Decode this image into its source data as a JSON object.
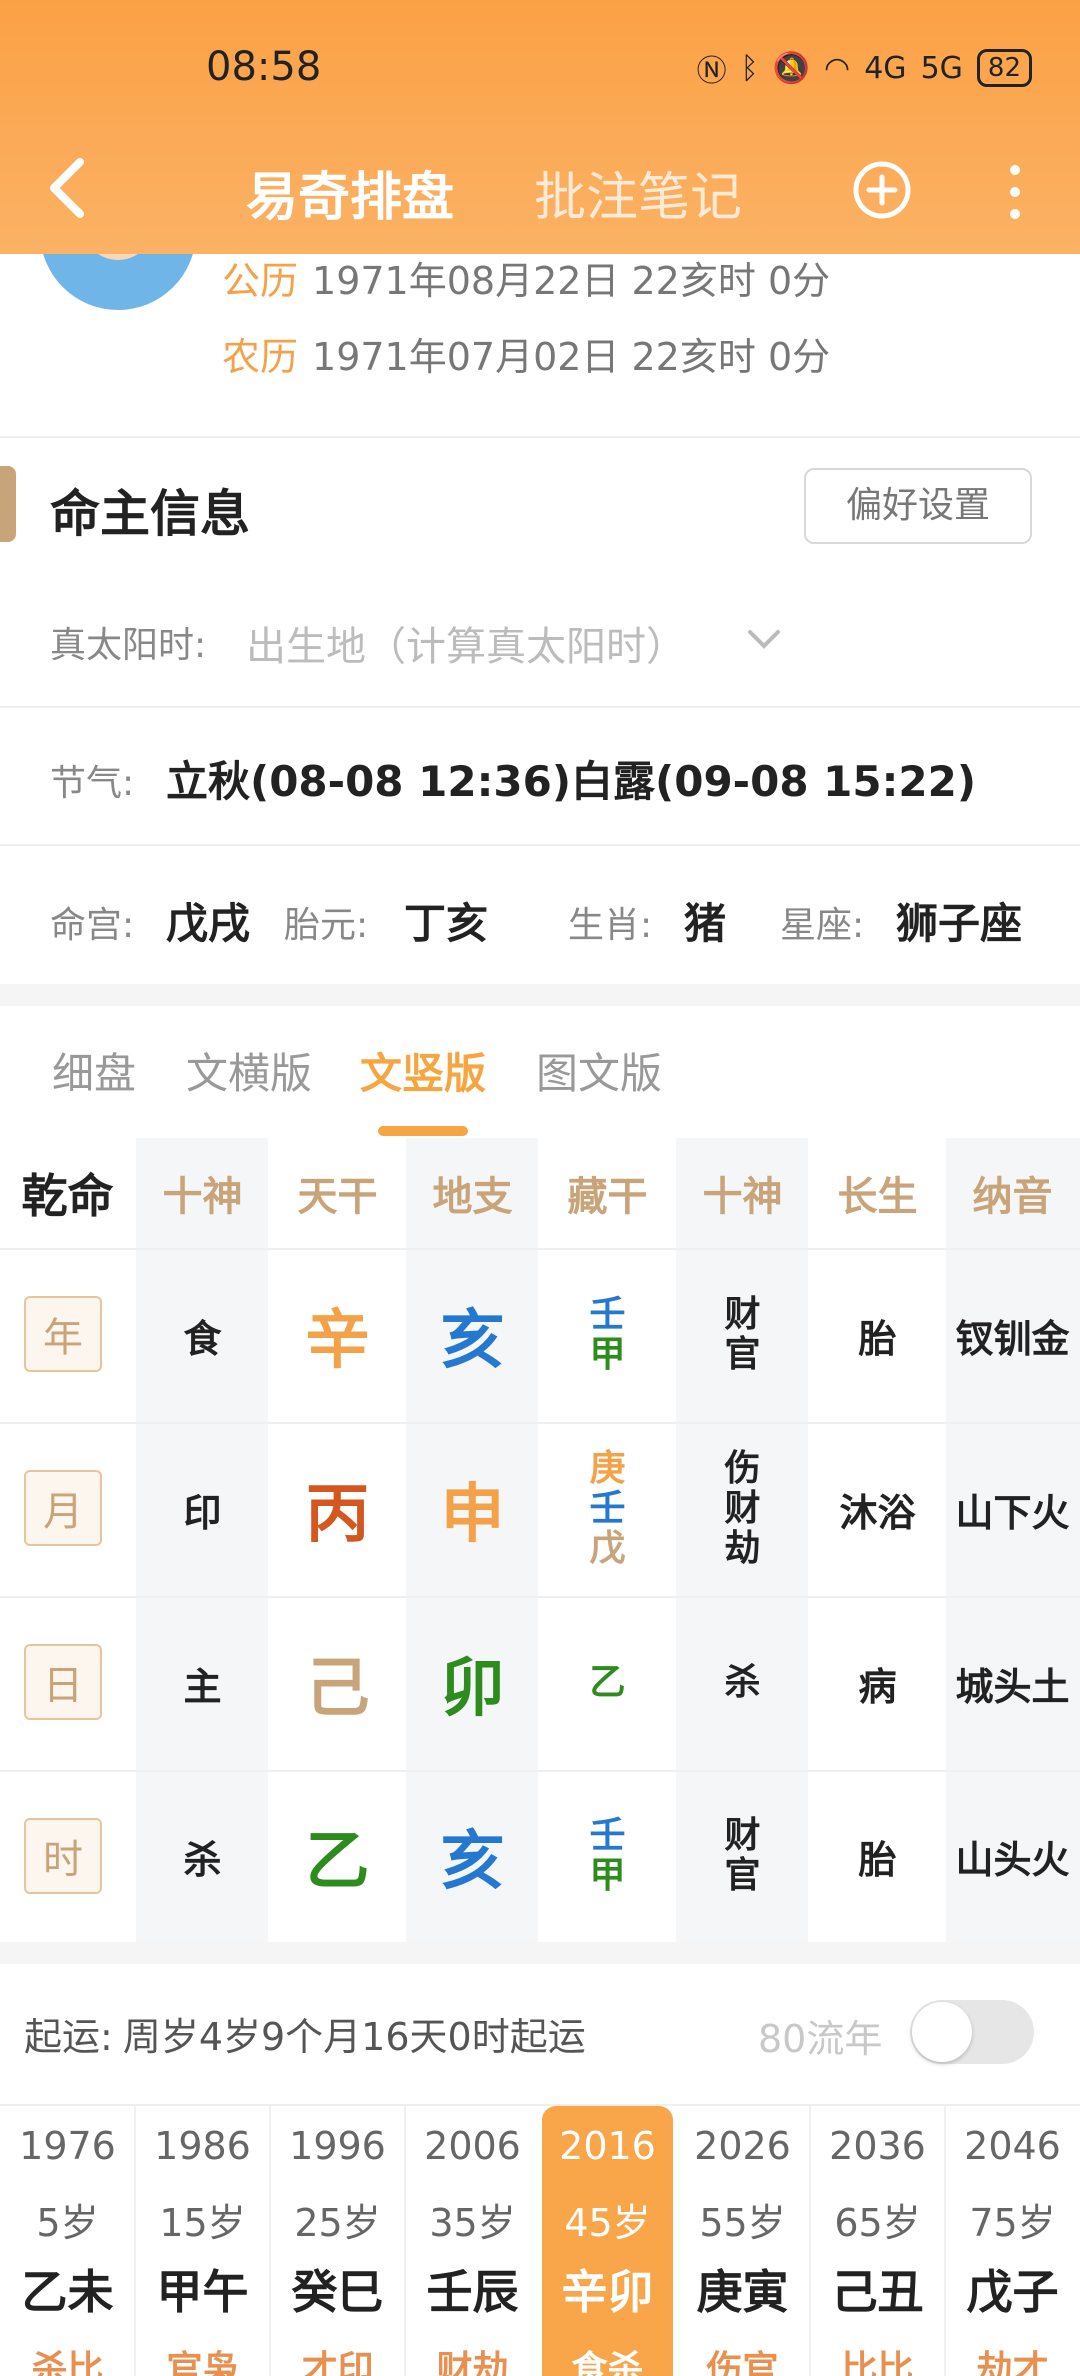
{
  "status": {
    "time": "08:58",
    "battery": "82",
    "net1": "4G",
    "net2": "5G"
  },
  "header": {
    "title": "易奇排盘",
    "subtitle": "批注笔记"
  },
  "profile": {
    "solar_label": "公历",
    "solar_value": "1971年08月22日 22亥时 0分",
    "lunar_label": "农历",
    "lunar_value": "1971年07月02日 22亥时 0分"
  },
  "section": {
    "title": "命主信息",
    "pref_button": "偏好设置"
  },
  "solar_time": {
    "label": "真太阳时:",
    "placeholder": "出生地（计算真太阳时）"
  },
  "jieqi": {
    "label": "节气:",
    "value": "立秋(08-08 12:36)白露(09-08 15:22)"
  },
  "info": {
    "minggong_label": "命宫:",
    "minggong": "戊戌",
    "taiyuan_label": "胎元:",
    "taiyuan": "丁亥",
    "shengxiao_label": "生肖:",
    "shengxiao": "猪",
    "xingzuo_label": "星座:",
    "xingzuo": "狮子座"
  },
  "tabs": [
    "细盘",
    "文横版",
    "文竖版",
    "图文版"
  ],
  "grid": {
    "headers": [
      "乾命",
      "十神",
      "天干",
      "地支",
      "藏干",
      "十神",
      "长生",
      "纳音"
    ],
    "rows": [
      {
        "pillar": "年",
        "god": "食",
        "stem": "辛",
        "branch": "亥",
        "hidden": [
          "壬",
          "甲"
        ],
        "hidden_gods": [
          "财",
          "官"
        ],
        "phase": "胎",
        "nayin": "钗钏金"
      },
      {
        "pillar": "月",
        "god": "印",
        "stem": "丙",
        "branch": "申",
        "hidden": [
          "庚",
          "壬",
          "戊"
        ],
        "hidden_gods": [
          "伤",
          "财",
          "劫"
        ],
        "phase": "沐浴",
        "nayin": "山下火"
      },
      {
        "pillar": "日",
        "god": "主",
        "stem": "己",
        "branch": "卯",
        "hidden": [
          "乙"
        ],
        "hidden_gods": [
          "杀"
        ],
        "phase": "病",
        "nayin": "城头土"
      },
      {
        "pillar": "时",
        "god": "杀",
        "stem": "乙",
        "branch": "亥",
        "hidden": [
          "壬",
          "甲"
        ],
        "hidden_gods": [
          "财",
          "官"
        ],
        "phase": "胎",
        "nayin": "山头火"
      }
    ],
    "colors": {
      "metal": "#f3a24a",
      "fire": "#d4571f",
      "earth": "#c8a47a",
      "wood": "#2e8b1e",
      "water": "#2478d0"
    }
  },
  "luck": {
    "label": "起运:",
    "text": "周岁4岁9个月16天0时起运",
    "flow_label": "80流年"
  },
  "dayun": [
    {
      "year": "1976",
      "age": "5岁",
      "gz": "乙未",
      "gods": "杀比"
    },
    {
      "year": "1986",
      "age": "15岁",
      "gz": "甲午",
      "gods": "官枭"
    },
    {
      "year": "1996",
      "age": "25岁",
      "gz": "癸巳",
      "gods": "才印"
    },
    {
      "year": "2006",
      "age": "35岁",
      "gz": "壬辰",
      "gods": "财劫"
    },
    {
      "year": "2016",
      "age": "45岁",
      "gz": "辛卯",
      "gods": "食杀"
    },
    {
      "year": "2026",
      "age": "55岁",
      "gz": "庚寅",
      "gods": "伤官"
    },
    {
      "year": "2036",
      "age": "65岁",
      "gz": "己丑",
      "gods": "比比"
    },
    {
      "year": "2046",
      "age": "75岁",
      "gz": "戊子",
      "gods": "劫才"
    }
  ]
}
